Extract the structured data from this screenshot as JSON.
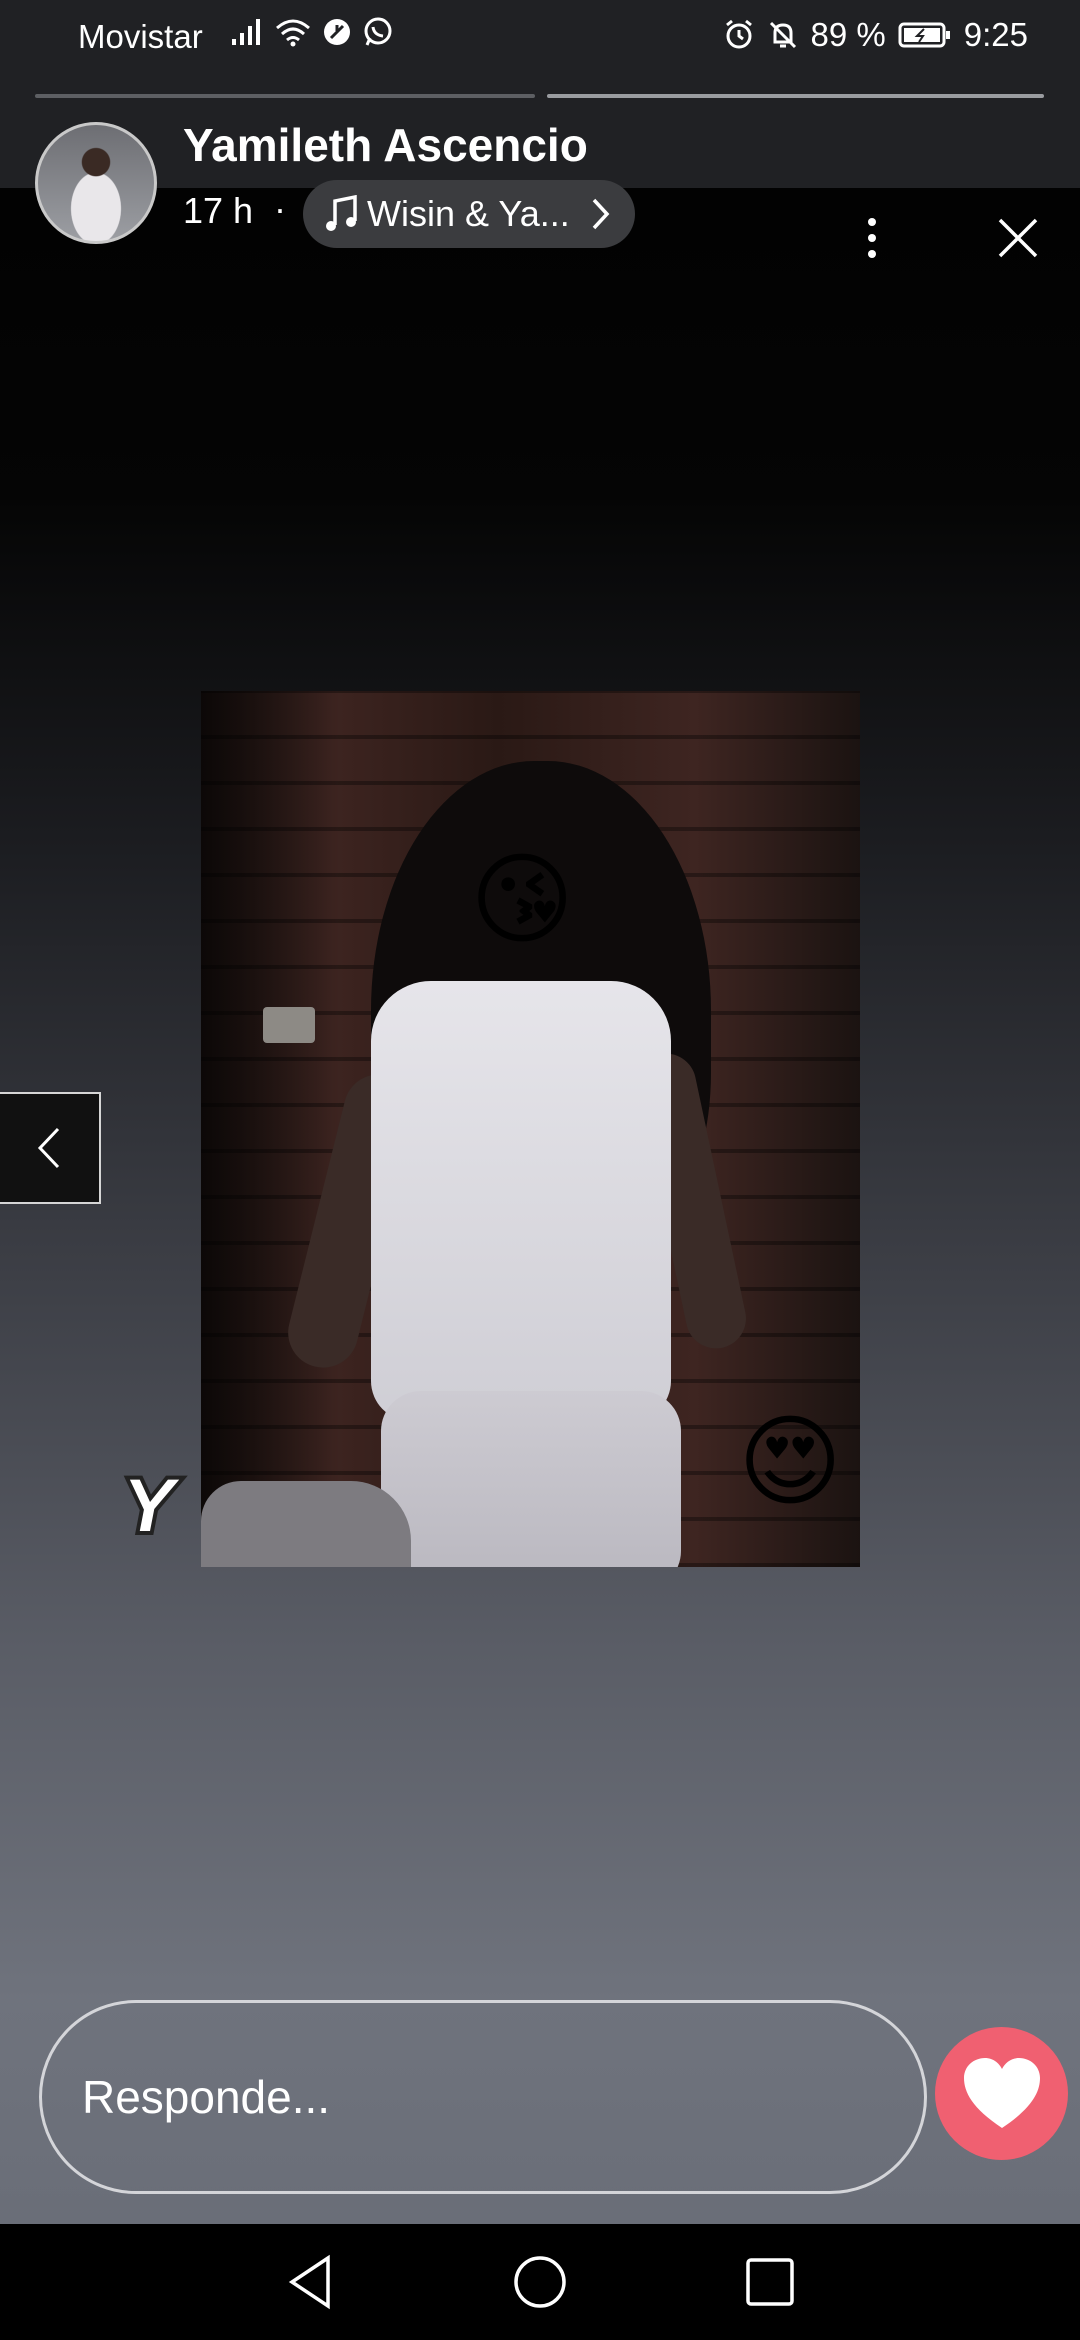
{
  "status_bar": {
    "carrier": "Movistar",
    "battery": "89 %",
    "time": "9:25",
    "icons": [
      "signal-icon",
      "wifi-icon",
      "data-saver-icon",
      "whatsapp-icon",
      "alarm-icon",
      "mute-icon",
      "battery-icon"
    ]
  },
  "story": {
    "segments_total": 2,
    "active_segment": 2,
    "username": "Yamileth Ascencio",
    "time_ago": "17 h",
    "separator": "·",
    "music_label": "Wisin & Ya...",
    "icons": [
      "avatar",
      "music-note-icon",
      "chevron-right-icon",
      "more-vertical-icon",
      "close-icon"
    ]
  },
  "media": {
    "stickers": [
      "😘",
      "😍"
    ],
    "text_sticker": "Y"
  },
  "navigation": {
    "prev_icon": "chevron-left-icon"
  },
  "reply": {
    "placeholder": "Responde...",
    "like_icon": "heart-icon",
    "like_color": "#f06071"
  },
  "system_nav": [
    "back-icon",
    "home-icon",
    "recents-icon"
  ]
}
